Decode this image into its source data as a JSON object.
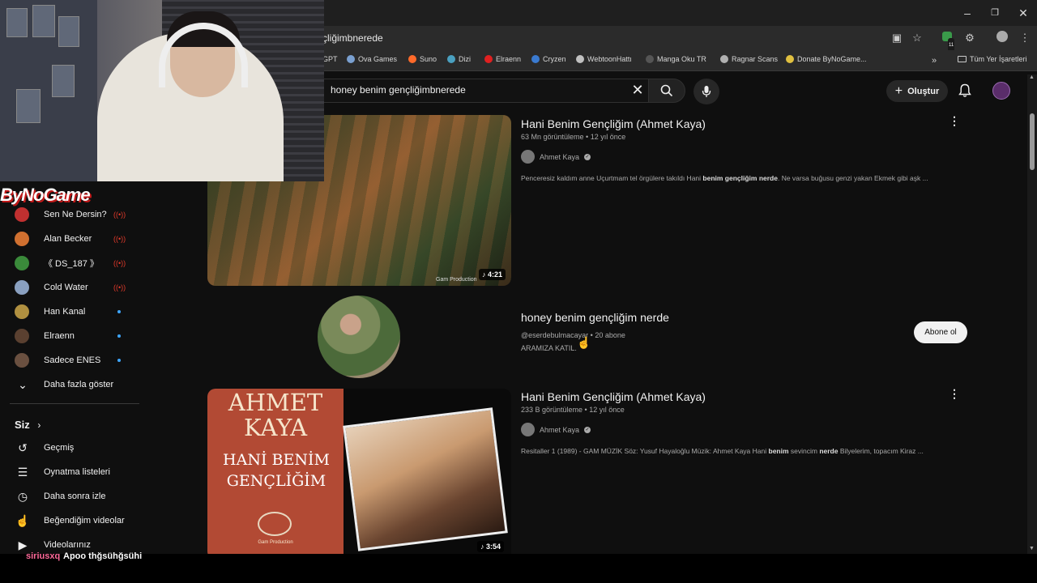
{
  "browser": {
    "url": "çliğimbnerede",
    "bookmarks": [
      {
        "label": "GPT",
        "color": "#9a9a9a"
      },
      {
        "label": "Ova Games",
        "color": "#7aa0d0"
      },
      {
        "label": "Suno",
        "color": "#ff6a2a"
      },
      {
        "label": "Dizi",
        "color": "#4aa0c0"
      },
      {
        "label": "Elraenn",
        "color": "#e02020"
      },
      {
        "label": "Cryzen",
        "color": "#3a7ad0"
      },
      {
        "label": "WebtoonHattı",
        "color": "#c0c0c0"
      },
      {
        "label": "Manga Oku TR",
        "color": "#555555"
      },
      {
        "label": "Ragnar Scans",
        "color": "#b0b0b0"
      },
      {
        "label": "Donate ByNoGame...",
        "color": "#e0c040"
      }
    ],
    "all_bookmarks_label": "Tüm Yer İşaretleri",
    "badge_count": "11"
  },
  "header": {
    "search_query": "honey benim gençliğimbnerede",
    "create_label": "Oluştur"
  },
  "overlay": {
    "brand_text": "ByNoGame",
    "chat_user": "siriusxq",
    "chat_message": "Apoo thğsühğsühi"
  },
  "sidebar": {
    "subscriptions": [
      {
        "label": "Sen Ne Dersin?",
        "status": "live",
        "avatar_color": "#c03030"
      },
      {
        "label": "Alan Becker",
        "status": "live",
        "avatar_color": "#d07030"
      },
      {
        "label": "《 DS_187 》",
        "status": "live",
        "avatar_color": "#3a8a3a"
      },
      {
        "label": "Cold Water",
        "status": "live",
        "avatar_color": "#8aa0c0"
      },
      {
        "label": "Han Kanal",
        "status": "new",
        "avatar_color": "#b09040"
      },
      {
        "label": "Elraenn",
        "status": "new",
        "avatar_color": "#5a4030"
      },
      {
        "label": "Sadece ENES",
        "status": "new",
        "avatar_color": "#6a5040"
      }
    ],
    "show_more_label": "Daha fazla göster",
    "you_label": "Siz",
    "you_items": [
      {
        "label": "Geçmiş",
        "icon": "history-icon"
      },
      {
        "label": "Oynatma listeleri",
        "icon": "playlist-icon"
      },
      {
        "label": "Daha sonra izle",
        "icon": "clock-icon"
      },
      {
        "label": "Beğendiğim videolar",
        "icon": "like-icon"
      },
      {
        "label": "Videolarınız",
        "icon": "video-icon"
      }
    ]
  },
  "results": {
    "video1": {
      "title": "Hani Benim Gençliğim (Ahmet Kaya)",
      "meta": "63 Mn görüntüleme • 12 yıl önce",
      "channel": "Ahmet Kaya",
      "desc_pre": "Penceresiz kaldım anne Uçurtmam tel örgülere takıldı Hani ",
      "desc_bold": "benim gençliğim nerde",
      "desc_post": ". Ne varsa buğusu genzi yakan Ekmek gibi aşk ...",
      "duration": "4:21",
      "watermark": "Gam Production"
    },
    "channel": {
      "name": "honey benim gençliğim nerde",
      "handle_meta": "@eserdebulmacayar • 20 abone",
      "description": "ARAMIZA KATIL.",
      "subscribe_label": "Abone ol"
    },
    "video2": {
      "title": "Hani Benim Gençliğim (Ahmet Kaya)",
      "meta": "233 B görüntüleme • 12 yıl önce",
      "channel": "Ahmet Kaya",
      "desc_pre": "Resitaller 1 (1989) - GAM MÜZİK Söz: Yusuf Hayaloğlu Müzik: Ahmet Kaya Hani ",
      "desc_bold": "benim",
      "desc_mid": " sevincim ",
      "desc_bold2": "nerde",
      "desc_post": " Bilyelerim, topacım Kiraz ...",
      "duration": "3:54",
      "cover_artist": "AHMET KAYA",
      "cover_title": "HANİ BENİM GENÇLİĞİM",
      "cover_label": "Gam Production"
    }
  }
}
